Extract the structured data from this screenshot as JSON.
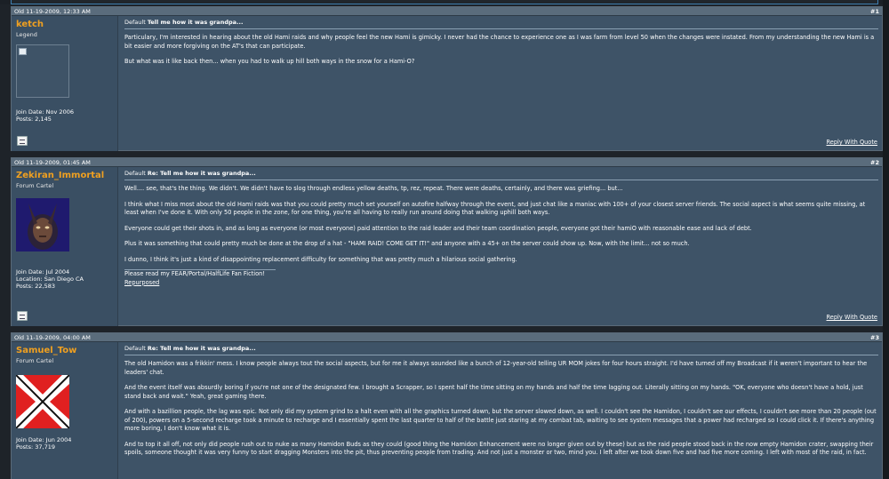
{
  "posts": [
    {
      "date": "Old 11-19-2009, 12:33 AM",
      "number": "#1",
      "username": "ketch",
      "user_title": "Legend",
      "join_date": "Join Date: Nov 2006",
      "location": "",
      "posts": "Posts: 2,145",
      "title_prefix": "Default",
      "title": "Tell me how it was grandpa...",
      "paragraphs": [
        "Particulary, I'm interested in hearing about the old Hami raids and why people feel the new Hami is gimicky. I never had the chance to experience one as I was farm from level 50 when the changes were instated. From my understanding the new Hami is a bit easier and more forgiving on the AT's that can participate.",
        "But what was it like back then... when you had to walk up hill both ways in the snow for a Hami-O?"
      ],
      "sig_line": "",
      "sig_link": "",
      "reply_label": "Reply With Quote"
    },
    {
      "date": "Old 11-19-2009, 01:45 AM",
      "number": "#2",
      "username": "Zekiran_Immortal",
      "user_title": "Forum Cartel",
      "join_date": "Join Date: Jul 2004",
      "location": "Location: San Diego CA",
      "posts": "Posts: 22,583",
      "title_prefix": "Default",
      "title": "Re: Tell me how it was grandpa...",
      "paragraphs": [
        "Well.... see, that's the thing. We didn't. We didn't have to slog through endless yellow deaths, tp, rez, repeat. There were deaths, certainly, and there was griefing... but...",
        "I think what I miss most about the old Hami raids was that you could pretty much set yourself on autofire halfway through the event, and just chat like a maniac with 100+ of your closest server friends. The social aspect is what seems quite missing, at least when I've done it. With only 50 people in the zone, for one thing, you're all having to really run around doing that walking uphill both ways.",
        "Everyone could get their shots in, and as long as everyone (or most everyone) paid attention to the raid leader and their team coordination people, everyone got their hamiO with reasonable ease and lack of debt.",
        "Plus it was something that could pretty much be done at the drop of a hat - \"HAMI RAID! COME GET IT!\" and anyone with a 45+ on the server could show up. Now, with the limit... not so much.",
        "I dunno, I think it's just a kind of disappointing replacement difficulty for something that was pretty much a hilarious social gathering."
      ],
      "sig_line": "Please read my FEAR/Portal/HalfLife Fan Fiction!",
      "sig_link": "Repurposed",
      "reply_label": "Reply With Quote"
    },
    {
      "date": "Old 11-19-2009, 04:00 AM",
      "number": "#3",
      "username": "Samuel_Tow",
      "user_title": "Forum Cartel",
      "join_date": "Join Date: Jun 2004",
      "location": "",
      "posts": "Posts: 37,719",
      "title_prefix": "Default",
      "title": "Re: Tell me how it was grandpa...",
      "paragraphs": [
        "The old Hamidon was a frikkin' mess. I know people always tout the social aspects, but for me it always sounded like a bunch of 12-year-old telling UR MOM jokes for four hours straight. I'd have turned off my Broadcast if it weren't important to hear the leaders' chat.",
        "And the event itself was absurdly boring if you're not one of the designated few. I brought a Scrapper, so I spent half the time sitting on my hands and half the time lagging out. Literally sitting on my hands. \"OK, everyone who doesn't have a hold, just stand back and wait.\" Yeah, great gaming there.",
        "And with a bazillion people, the lag was epic. Not only did my system grind to a halt even with all the graphics turned down, but the server slowed down, as well. I couldn't see the Hamidon, I couldn't see our effects, I couldn't see more than 20 people (out of 200), powers on a 5-second recharge took a minute to recharge and I essentially spent the last quarter to half of the battle just staring at my combat tab, waiting to see system messages that a power had recharged so I could click it. If there's anything more boring, I don't know what it is.",
        "And to top it all off, not only did people rush out to nuke as many Hamidon Buds as they could (good thing the Hamidon Enhancement were no longer given out by these) but as the raid people stood back in the now empty Hamidon crater, swapping their spoils, someone thought it was very funny to start dragging Monsters into the pit, thus preventing people from trading. And not just a monster or two, mind you. I left after we took down five and had five more coming. I left with most of the raid, in fact."
      ],
      "sig_line": "",
      "sig_link": "",
      "reply_label": ""
    }
  ],
  "colors": {
    "page_bg": "#1e2329",
    "post_bg": "#3e5367",
    "header_bg": "#5a6c7c",
    "username": "#f0a020"
  }
}
